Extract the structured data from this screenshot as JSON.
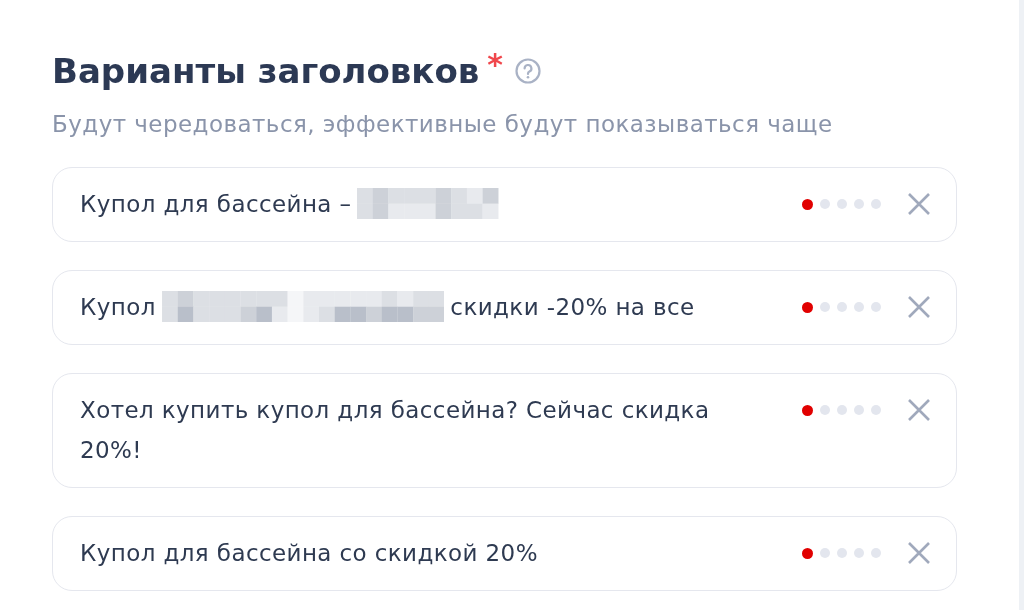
{
  "section": {
    "title": "Варианты заголовков",
    "required_mark": "*",
    "hint": "Будут чередоваться, эффективные будут показываться чаще"
  },
  "headlines": [
    {
      "parts": [
        {
          "kind": "text",
          "text": "Купол для бассейна –"
        },
        {
          "kind": "redacted"
        }
      ],
      "stars": 1
    },
    {
      "parts": [
        {
          "kind": "text",
          "text": "Купол"
        },
        {
          "kind": "redacted"
        },
        {
          "kind": "text",
          "text": "скидки -20% на все"
        }
      ],
      "stars": 1
    },
    {
      "parts": [
        {
          "kind": "text",
          "text": "Хотел купить купол для бассейна? Сейчас скидка 20%!"
        }
      ],
      "stars": 1
    },
    {
      "parts": [
        {
          "kind": "text",
          "text": "Купол для бассейна со скидкой 20%"
        }
      ],
      "stars": 1
    }
  ]
}
